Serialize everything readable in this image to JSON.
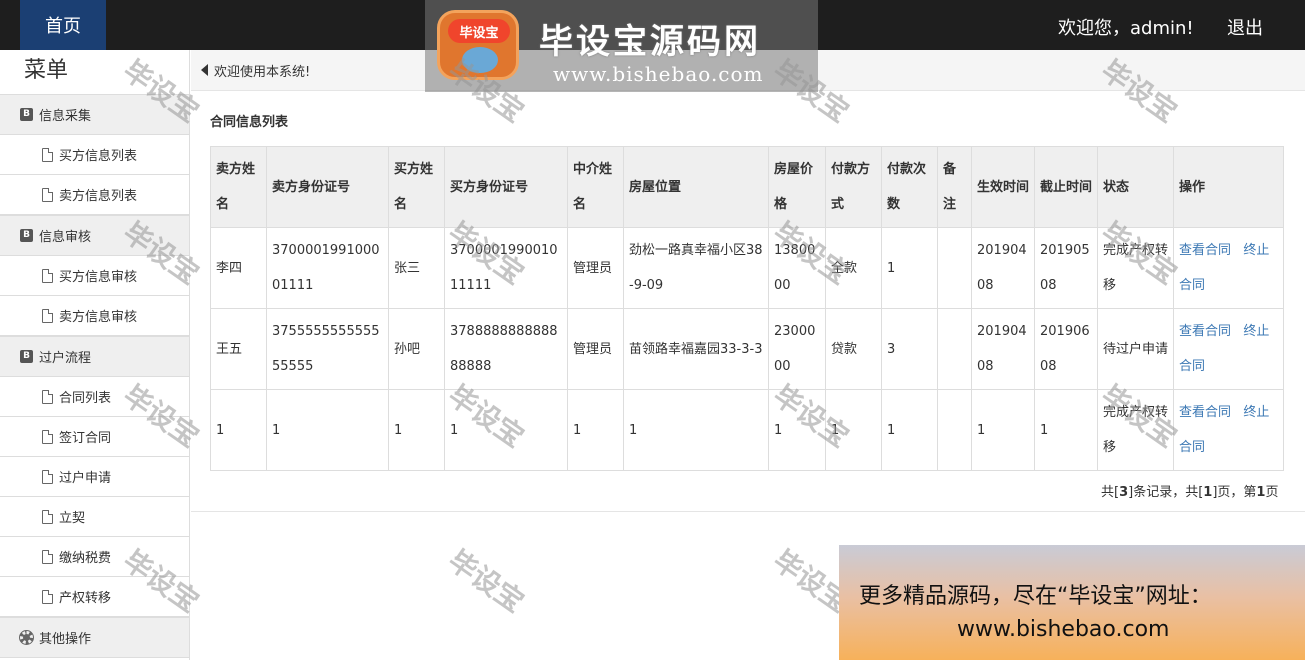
{
  "header": {
    "home_label": "首页",
    "welcome_text": "欢迎您，admin!",
    "logout_label": "退出",
    "brand_badge": "毕设宝",
    "brand_name": "毕设宝源码网",
    "brand_url": "www.bishebao.com"
  },
  "sidebar": {
    "title": "菜单",
    "groups": [
      {
        "label": "信息采集",
        "icon": "b-icon",
        "items": [
          "买方信息列表",
          "卖方信息列表"
        ]
      },
      {
        "label": "信息审核",
        "icon": "b-icon",
        "items": [
          "买方信息审核",
          "卖方信息审核"
        ]
      },
      {
        "label": "过户流程",
        "icon": "b-icon",
        "items": [
          "合同列表",
          "签订合同",
          "过户申请",
          "立契",
          "缴纳税费",
          "产权转移"
        ]
      },
      {
        "label": "其他操作",
        "icon": "gear-icon",
        "items": []
      }
    ]
  },
  "main": {
    "notice": "欢迎使用本系统!",
    "section_title": "合同信息列表",
    "table": {
      "headers": [
        "卖方姓名",
        "卖方身份证号",
        "买方姓名",
        "买方身份证号",
        "中介姓名",
        "房屋位置",
        "房屋价格",
        "付款方式",
        "付款次数",
        "备注",
        "生效时间",
        "截止时间",
        "状态",
        "操作"
      ],
      "rows": [
        {
          "seller": "李四",
          "seller_id": "370000199100001111",
          "buyer": "张三",
          "buyer_id": "370000199001011111",
          "agent": "管理员",
          "location": "劲松一路真幸福小区38-9-09",
          "price": "1380000",
          "pay_method": "全款",
          "pay_times": "1",
          "note": "",
          "start": "20190408",
          "end": "20190508",
          "status": "完成产权转移",
          "view_label": "查看合同",
          "stop_label": "终止合同"
        },
        {
          "seller": "王五",
          "seller_id": "375555555555555555",
          "buyer": "孙吧",
          "buyer_id": "378888888888888888",
          "agent": "管理员",
          "location": "苗领路幸福嘉园33-3-3",
          "price": "2300000",
          "pay_method": "贷款",
          "pay_times": "3",
          "note": "",
          "start": "20190408",
          "end": "20190608",
          "status": "待过户申请",
          "view_label": "查看合同",
          "stop_label": "终止合同"
        },
        {
          "seller": "1",
          "seller_id": "1",
          "buyer": "1",
          "buyer_id": "1",
          "agent": "1",
          "location": "1",
          "price": "1",
          "pay_method": "1",
          "pay_times": "1",
          "note": "",
          "start": "1",
          "end": "1",
          "status": "完成产权转移",
          "view_label": "查看合同",
          "stop_label": "终止合同"
        }
      ]
    },
    "pager": {
      "prefix": "共[",
      "total_records": "3",
      "mid1": "]条记录，共[",
      "total_pages": "1",
      "mid2": "]页，第",
      "current_page": "1",
      "suffix": "页"
    }
  },
  "watermark_text": "毕设宝",
  "ad": {
    "line1": "更多精品源码，尽在“毕设宝”网址：",
    "line2": "www.bishebao.com"
  }
}
